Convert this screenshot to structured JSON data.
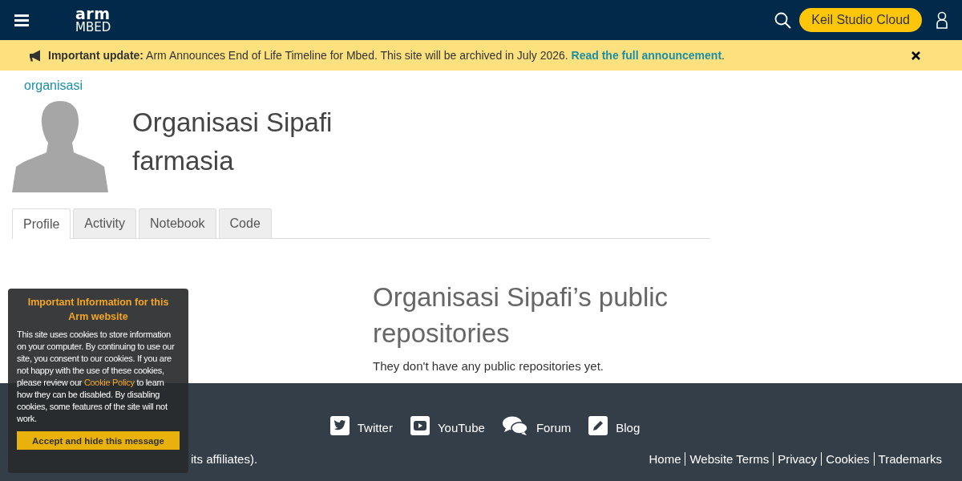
{
  "header": {
    "logo_top": "arm",
    "logo_bottom": "MBED",
    "cta": "Keil Studio Cloud"
  },
  "banner": {
    "label": "Important update:",
    "text": "Arm Announces End of Life Timeline for Mbed. This site will be archived in July 2026.",
    "link": "Read the full announcement",
    "trail": "."
  },
  "breadcrumb": "organisasi",
  "profile": {
    "name": "Organisasi Sipafi farmasia"
  },
  "tabs": [
    {
      "label": "Profile",
      "selected": true
    },
    {
      "label": "Activity",
      "selected": false
    },
    {
      "label": "Notebook",
      "selected": false
    },
    {
      "label": "Code",
      "selected": false
    }
  ],
  "repositories": {
    "heading": "Organisasi Sipafi’s public repositories",
    "text": "They don't have any public repositories yet."
  },
  "footer": {
    "social": [
      {
        "kind": "twitter",
        "label": "Twitter"
      },
      {
        "kind": "youtube",
        "label": "YouTube"
      },
      {
        "kind": "forum",
        "label": "Forum"
      },
      {
        "kind": "blog",
        "label": "Blog"
      }
    ],
    "links": [
      "Home",
      "Website Terms",
      "Privacy",
      "Cookies",
      "Trademarks"
    ],
    "copyright": "its affiliates)."
  },
  "cookie_notice": {
    "title": "Important Information for this Arm website",
    "text_before": "This site uses cookies to store information on your computer. By continuing to use our site, you consent to our cookies. If you are not happy with the use of these cookies, please review our",
    "link": "Cookie Policy",
    "text_after": "to learn how they can be disabled. By disabling cookies, some features of the site will not work.",
    "button": "Accept and hide this message"
  }
}
